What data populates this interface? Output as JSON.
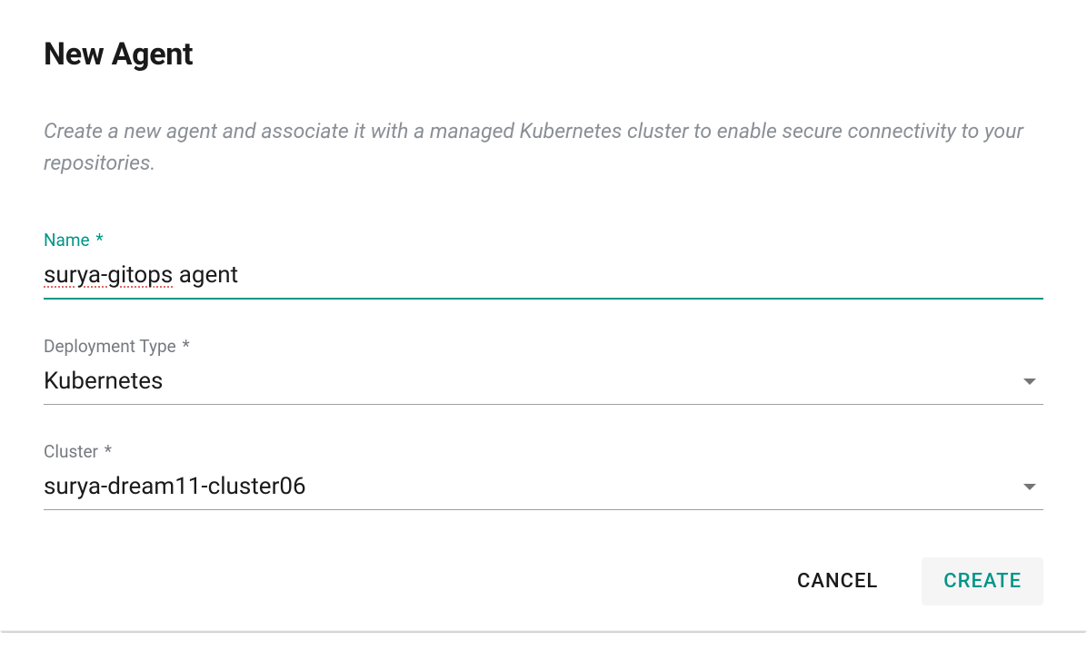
{
  "dialog": {
    "title": "New Agent",
    "description": "Create a new agent and associate it with a managed Kubernetes cluster to enable secure connectivity to your repositories."
  },
  "form": {
    "name": {
      "label": "Name",
      "required": "*",
      "value_prefix": "surya-gitops",
      "value_suffix": " agent"
    },
    "deployment_type": {
      "label": "Deployment Type",
      "required": "*",
      "value": "Kubernetes"
    },
    "cluster": {
      "label": "Cluster",
      "required": "*",
      "value": "surya-dream11-cluster06"
    }
  },
  "actions": {
    "cancel": "CANCEL",
    "create": "CREATE"
  }
}
